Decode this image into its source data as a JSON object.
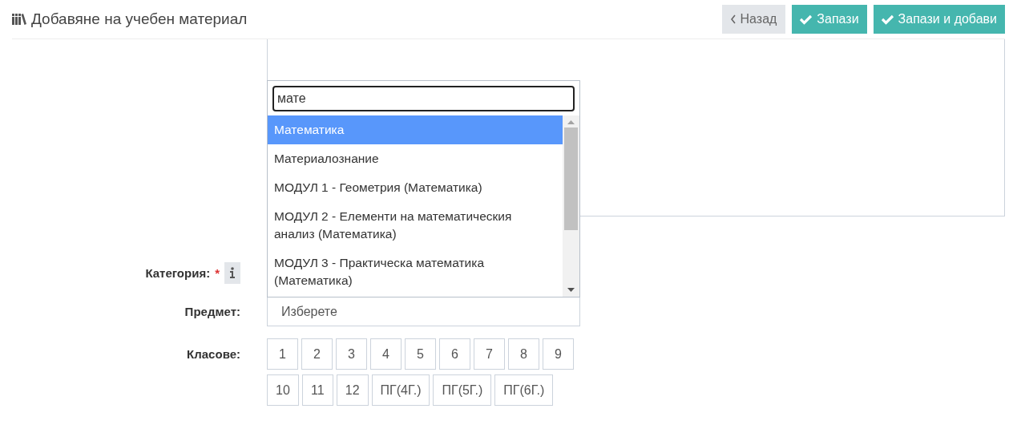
{
  "header": {
    "title": "Добавяне на учебен материал",
    "buttons": [
      {
        "kind": "back",
        "label": "Назад"
      },
      {
        "kind": "save",
        "label": "Запази"
      },
      {
        "kind": "save",
        "label": "Запази и добави"
      }
    ]
  },
  "dropdown": {
    "search": {
      "value": "мате"
    },
    "options": [
      {
        "label": "Математика",
        "selected": true
      },
      {
        "label": "Материалознание",
        "selected": false
      },
      {
        "label": "МОДУЛ 1 - Геометрия (Математика)",
        "selected": false
      },
      {
        "label": "МОДУЛ 2 - Елементи на математическия анализ (Математика)",
        "selected": false
      },
      {
        "label": "МОДУЛ 3 - Практическа математика (Математика)",
        "selected": false
      }
    ]
  },
  "form": {
    "fields": [
      {
        "kind": "category",
        "label": "Категория:",
        "required_mark": "*",
        "info": true
      },
      {
        "kind": "select",
        "label": "Предмет:",
        "placeholder": "Изберете"
      },
      {
        "kind": "grades",
        "label": "Класове:",
        "options": [
          {
            "label": "1",
            "selected": false
          },
          {
            "label": "2",
            "selected": false
          },
          {
            "label": "3",
            "selected": false
          },
          {
            "label": "4",
            "selected": false
          },
          {
            "label": "5",
            "selected": false
          },
          {
            "label": "6",
            "selected": false
          },
          {
            "label": "7",
            "selected": false
          },
          {
            "label": "8",
            "selected": false
          },
          {
            "label": "9",
            "selected": false
          },
          {
            "label": "10",
            "selected": false
          },
          {
            "label": "11",
            "selected": false
          },
          {
            "label": "12",
            "selected": false
          },
          {
            "label": "ПГ(4Г.)",
            "selected": false
          },
          {
            "label": "ПГ(5Г.)",
            "selected": false
          },
          {
            "label": "ПГ(6Г.)",
            "selected": false
          }
        ]
      }
    ]
  }
}
